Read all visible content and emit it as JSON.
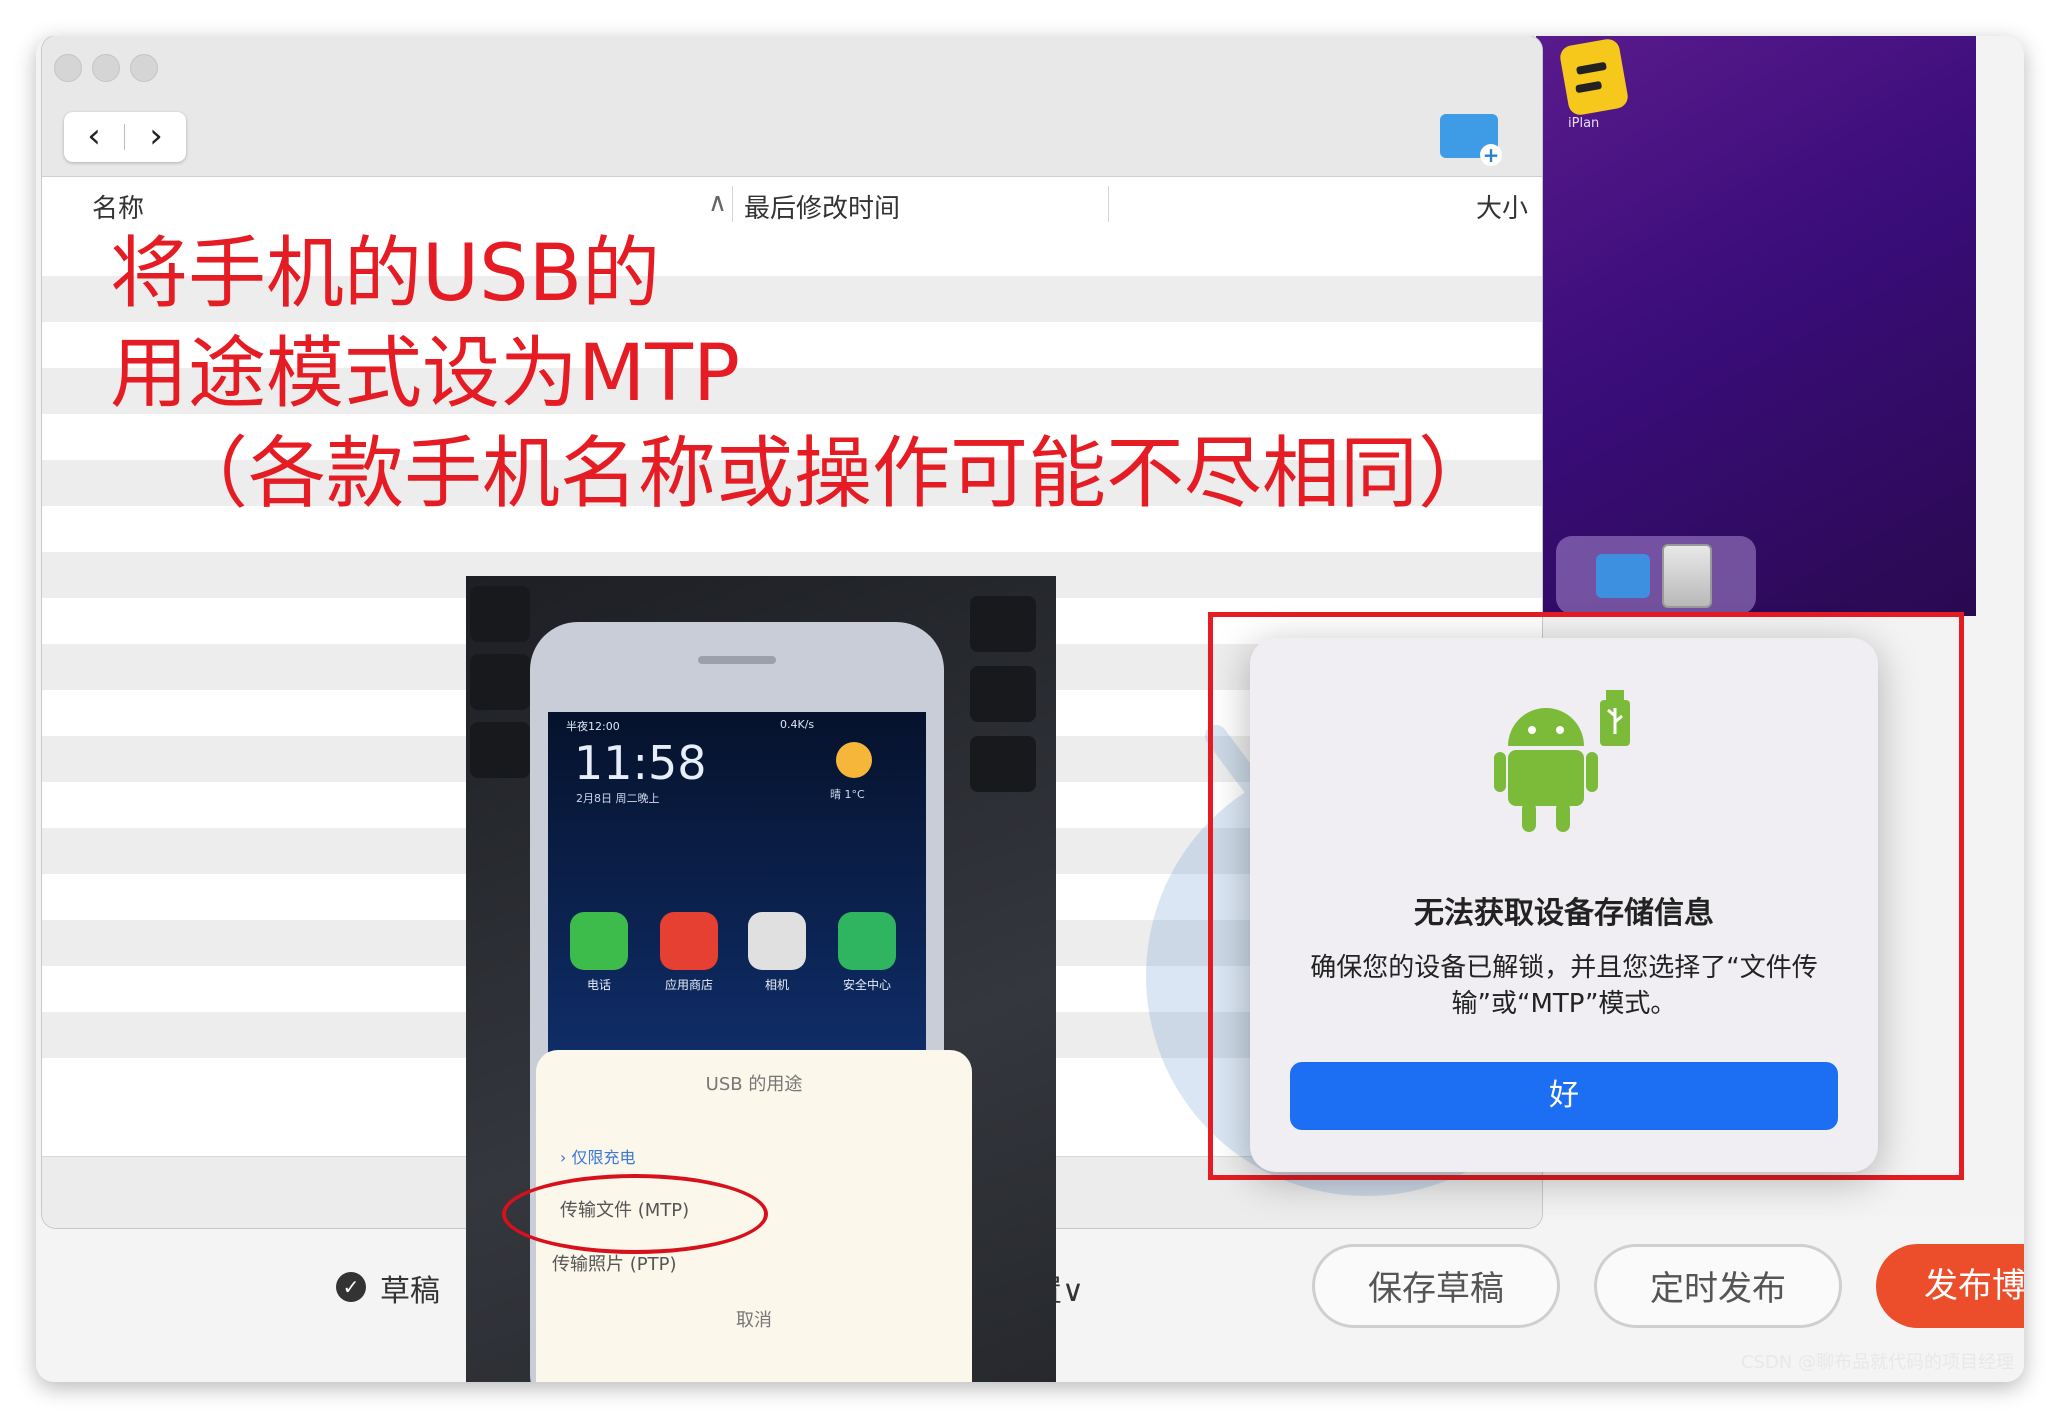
{
  "desktop": {
    "app_label": "iPlan"
  },
  "finder": {
    "columns": {
      "name": "名称",
      "modified": "最后修改时间",
      "size": "大小"
    },
    "nav": {
      "back": "‹",
      "forward": "›"
    }
  },
  "annotation": {
    "line1": "将手机的USB的",
    "line2": "用途模式设为MTP",
    "line3": "（各款手机名称或操作可能不尽相同）"
  },
  "phone": {
    "status_left": "半夜12:00",
    "status_right": "0.4K/s",
    "clock": "11:58",
    "date": "2月8日 周二晚上",
    "weather": "晴 1°C",
    "apps": [
      {
        "label": "电话",
        "color": "#3dbb4b"
      },
      {
        "label": "应用商店",
        "color": "#e64033"
      },
      {
        "label": "相机",
        "color": "#e0e0e0"
      },
      {
        "label": "安全中心",
        "color": "#2fb45f"
      }
    ],
    "usb_sheet": {
      "title": "USB 的用途",
      "options": [
        "仅限充电",
        "传输文件 (MTP)",
        "传输照片 (PTP)"
      ],
      "cancel": "取消"
    }
  },
  "dialog": {
    "title": "无法获取设备存储信息",
    "message": "确保您的设备已解锁，并且您选择了“文件传输”或“MTP”模式。",
    "ok": "好"
  },
  "editor_bar": {
    "draft": "草稿",
    "settings": "设置∨",
    "save_draft": "保存草稿",
    "schedule": "定时发布",
    "publish": "发布博"
  },
  "watermark": "CSDN @聊布品就代码的项目经理"
}
